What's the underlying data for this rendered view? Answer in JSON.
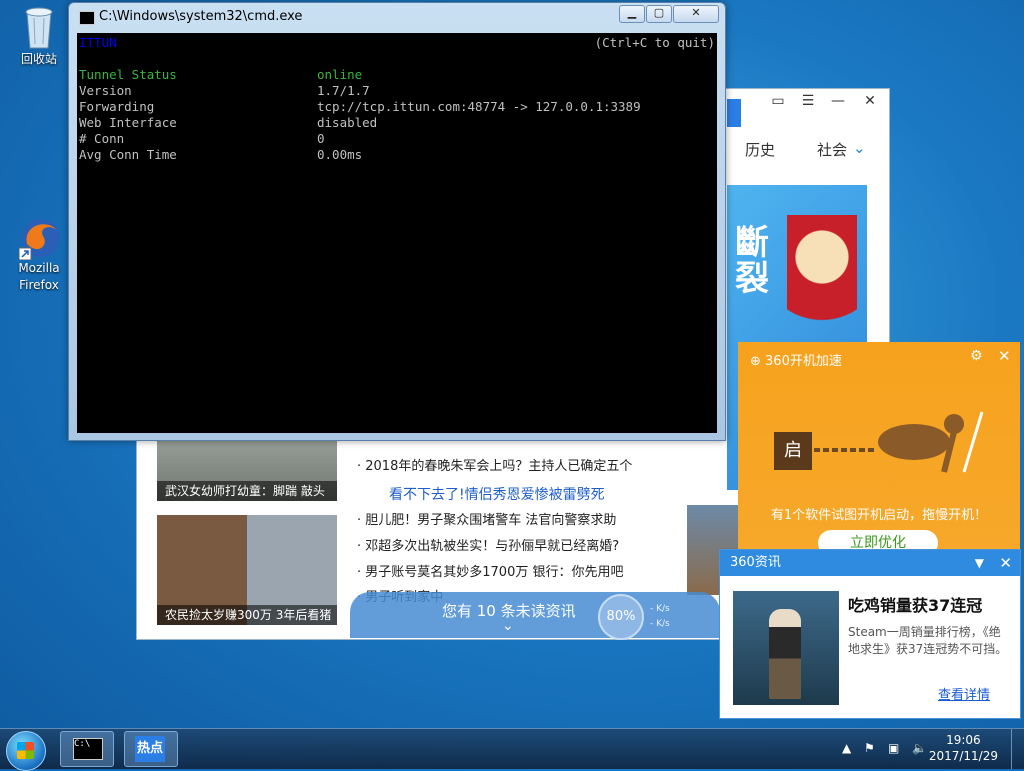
{
  "desktop": {
    "recycle_bin": "回收站",
    "firefox": "Mozilla Firefox"
  },
  "cmd": {
    "title": "C:\\Windows\\system32\\cmd.exe",
    "header_left": "ITTUN",
    "header_right": "(Ctrl+C to quit)",
    "rows": [
      {
        "label": "Tunnel Status",
        "value": "online"
      },
      {
        "label": "Version",
        "value": "1.7/1.7"
      },
      {
        "label": "Forwarding",
        "value": "tcp://tcp.ittun.com:48774 -> 127.0.0.1:3389"
      },
      {
        "label": "Web Interface",
        "value": "disabled"
      },
      {
        "label": "# Conn",
        "value": "0"
      },
      {
        "label": "Avg Conn Time",
        "value": "0.00ms"
      }
    ]
  },
  "news_window": {
    "tabs": [
      "历史",
      "社会"
    ],
    "thumb1_caption": "武汉女幼师打幼童：脚踹 敲头",
    "thumb2_caption": "农民捡太岁赚300万 3年后看猪",
    "headline": "看不下去了!情侣秀恩爱惨被雷劈死",
    "lines": [
      "· 2018年的春晚朱军会上吗？主持人已确定五个",
      "· 胆儿肥！男子聚众围堵警车 法官向警察求助",
      "· 邓超多次出轨被坐实！与孙俪早就已经离婚?",
      "· 男子账号莫名其妙多1700万 银行：你先用吧",
      "· 男子听到家中"
    ]
  },
  "unread_bar": {
    "text": "您有 10 条未读资讯",
    "gauge": "80%",
    "up_speed": "- K/s",
    "down_speed": "- K/s"
  },
  "boost_panel": {
    "title": "360开机加速",
    "lock_char": "启",
    "message": "有1个软件试图开机启动，拖慢开机！",
    "button": "立即优化"
  },
  "news360_panel": {
    "title": "360资讯",
    "headline": "吃鸡销量获37连冠",
    "description": "Steam一周销量排行榜，《绝地求生》获37连冠势不可挡。",
    "more_link": "查看详情"
  },
  "taskbar": {
    "hotspot_label": "热点",
    "time": "19:06",
    "date": "2017/11/29"
  },
  "colors": {
    "console_green": "#3cb43c",
    "console_blue": "#0000ee",
    "boost_orange": "#f6a21e",
    "news_blue": "#2f8be0"
  }
}
